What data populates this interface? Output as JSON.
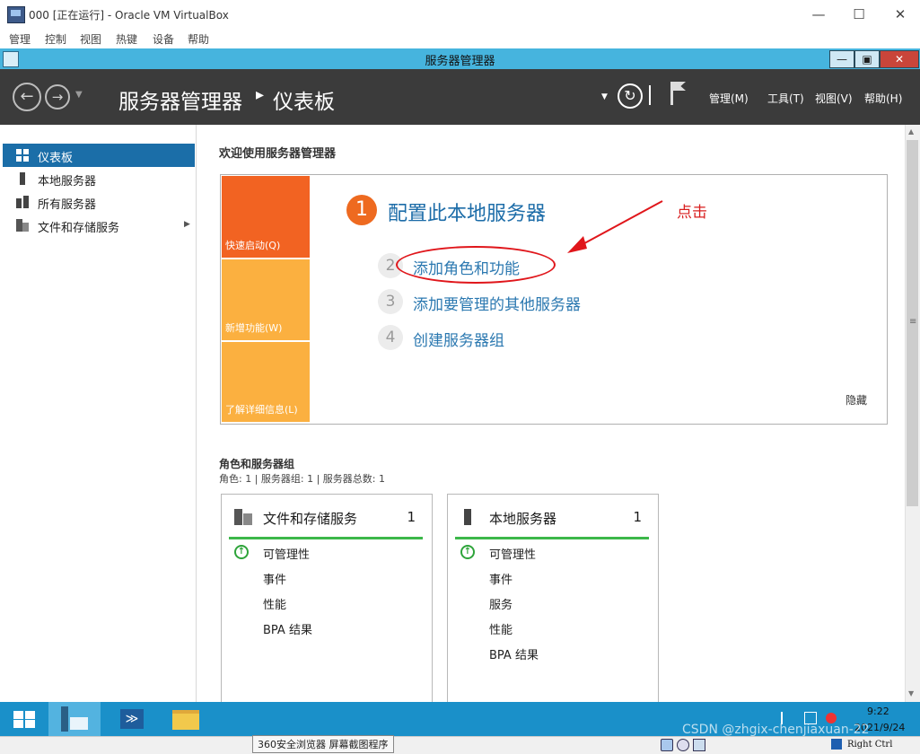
{
  "vbox": {
    "title": "000 [正在运行] - Oracle VM VirtualBox",
    "controls": [
      "—",
      "☐",
      "✕"
    ],
    "menu": [
      "管理",
      "控制",
      "视图",
      "热键",
      "设备",
      "帮助"
    ]
  },
  "sm_window": {
    "title": "服务器管理器",
    "controls": [
      "—",
      "▣",
      "✕"
    ]
  },
  "header": {
    "title": "服务器管理器",
    "separator": "▸",
    "subtitle": "仪表板",
    "menus": [
      "管理(M)",
      "工具(T)",
      "视图(V)",
      "帮助(H)"
    ],
    "refresh_icon": "refresh-icon",
    "flag_icon": "flag-icon"
  },
  "sidebar": {
    "items": [
      {
        "label": "仪表板",
        "icon": "dashboard-icon",
        "active": true
      },
      {
        "label": "本地服务器",
        "icon": "server-icon"
      },
      {
        "label": "所有服务器",
        "icon": "servers-icon"
      },
      {
        "label": "文件和存储服务",
        "icon": "storage-icon",
        "expander": "▶"
      }
    ]
  },
  "welcome": {
    "title": "欢迎使用服务器管理器",
    "tiles": [
      "快速启动(Q)",
      "新增功能(W)",
      "了解详细信息(L)"
    ],
    "step1_num": "1",
    "step1_text": "配置此本地服务器",
    "steps": [
      {
        "num": "2",
        "text": "添加角色和功能"
      },
      {
        "num": "3",
        "text": "添加要管理的其他服务器"
      },
      {
        "num": "4",
        "text": "创建服务器组"
      }
    ],
    "hide": "隐藏",
    "annotation": "点击"
  },
  "roles": {
    "title": "角色和服务器组",
    "subtitle": "角色: 1 | 服务器组: 1 | 服务器总数: 1",
    "cards": [
      {
        "title": "文件和存储服务",
        "count": "1",
        "rows": [
          "可管理性",
          "事件",
          "性能",
          "BPA 结果"
        ]
      },
      {
        "title": "本地服务器",
        "count": "1",
        "rows": [
          "可管理性",
          "事件",
          "服务",
          "性能",
          "BPA 结果"
        ]
      }
    ]
  },
  "taskbar": {
    "time": "9:22",
    "date": "2021/9/24",
    "tooltip": "360安全浏览器 屏幕截图程序",
    "host_key": "Right Ctrl",
    "watermark": "CSDN @zhgix-chenjiaxuan-22"
  },
  "colors": {
    "header_bg": "#3b3b3b",
    "titlebar": "#46b4de",
    "active_nav": "#1b6ea8",
    "quickstart": "#f26322",
    "whatsnew": "#fbb040",
    "accent_link": "#2b78b0",
    "taskbar": "#1a90c9"
  }
}
